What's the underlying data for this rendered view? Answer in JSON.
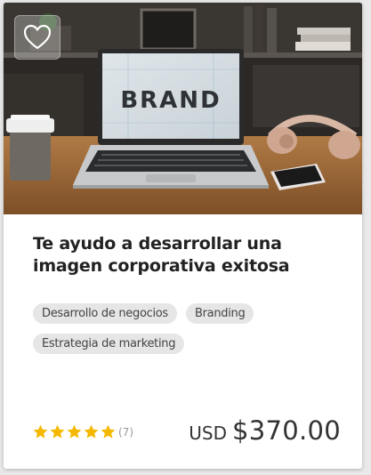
{
  "listing": {
    "title": "Te ayudo a desarrollar una imagen corporativa exitosa",
    "image_screen_text": "BRAND",
    "tags": [
      "Desarrollo de negocios",
      "Branding",
      "Estrategia de marketing"
    ],
    "rating": {
      "stars": 5,
      "count_label": "(7)"
    },
    "price": {
      "currency": "USD",
      "amount": "$370.00"
    }
  },
  "icons": {
    "favorite": "heart-outline-icon",
    "star": "star-icon"
  },
  "colors": {
    "star": "#f5b800",
    "tag_bg": "#e6e6e6",
    "title": "#222222"
  }
}
